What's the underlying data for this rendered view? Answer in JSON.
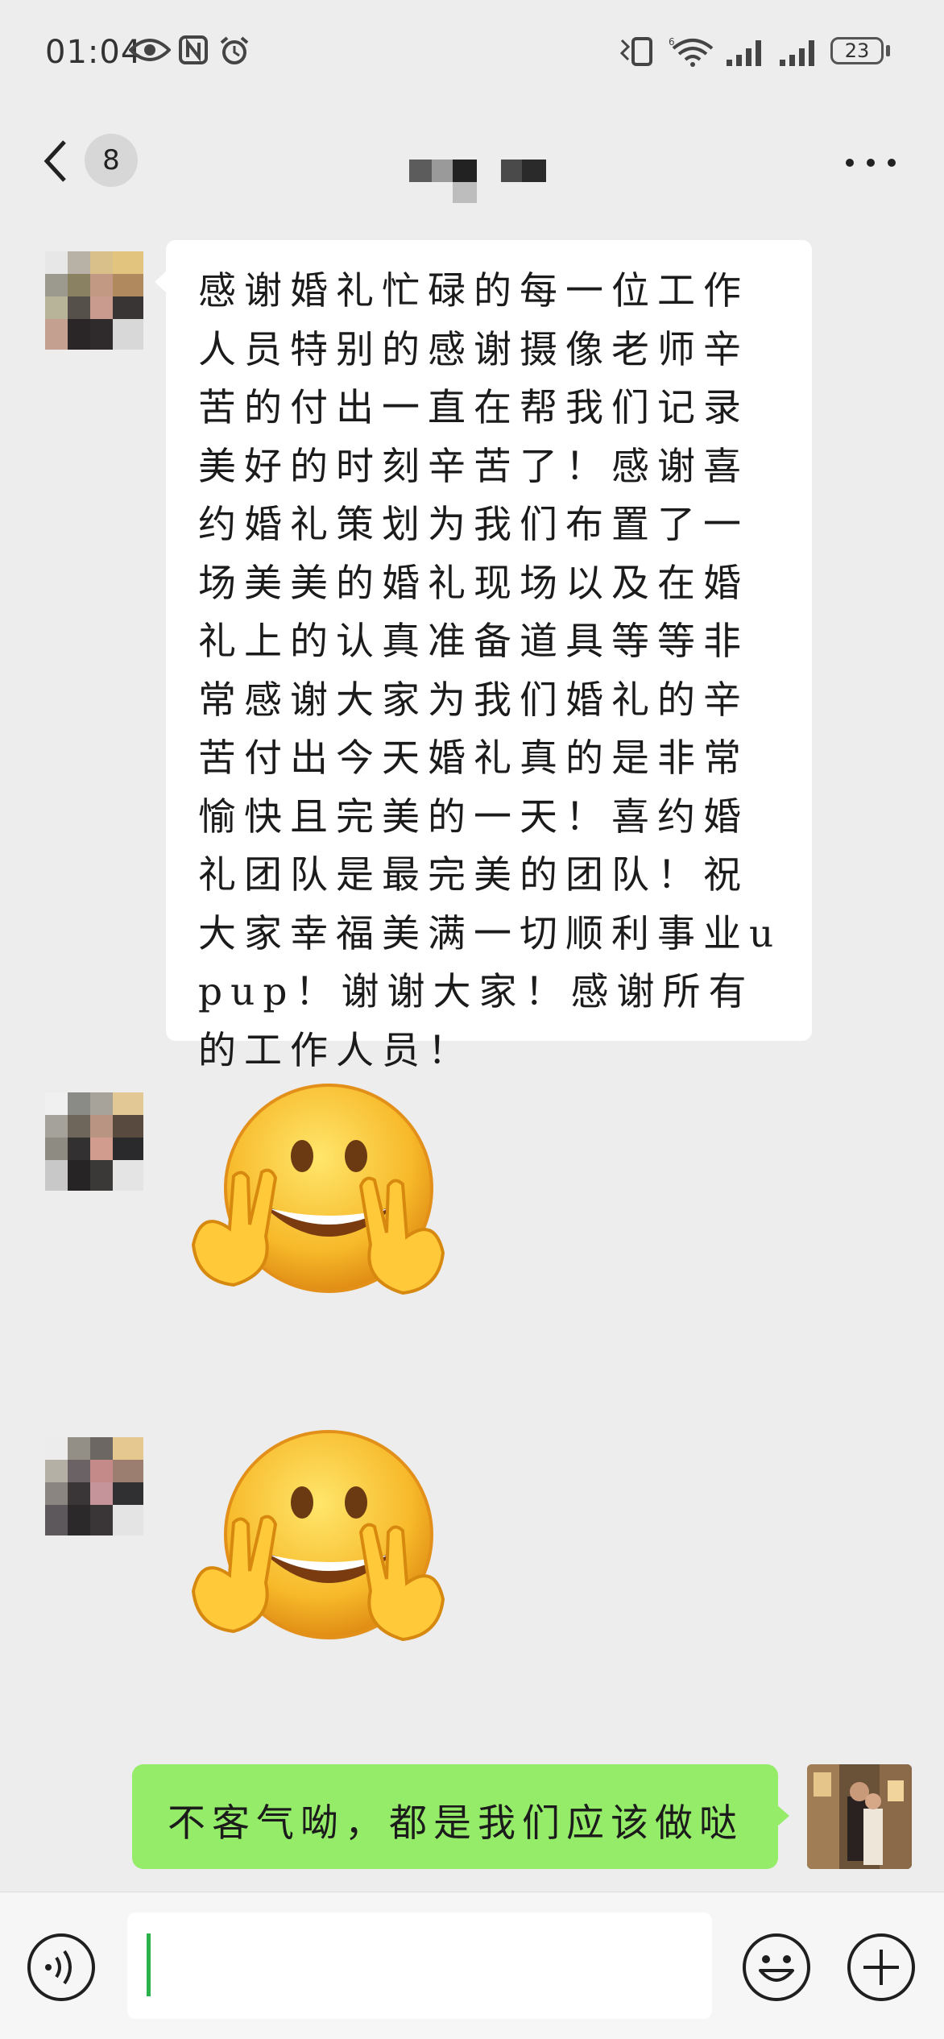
{
  "status_bar": {
    "time": "01:04",
    "battery": "23",
    "icons": [
      "eye-icon",
      "nfc-icon",
      "alarm-icon",
      "vibrate-icon",
      "wifi-6-icon",
      "signal-icon",
      "signal-icon",
      "battery-icon"
    ]
  },
  "header": {
    "unread_count": "8",
    "title_obscured": true,
    "back_icon": "chevron-left-icon",
    "more_icon": "more-dots-icon"
  },
  "messages": [
    {
      "direction": "incoming",
      "type": "text",
      "text": "感谢婚礼忙碌的每一位工作人员特别的感谢摄像老师辛苦的付出一直在帮我们记录美好的时刻辛苦了！感谢喜约婚礼策划为我们布置了一场美美的婚礼现场以及在婚礼上的认真准备道具等等非常感谢大家为我们婚礼的辛苦付出今天婚礼真的是非常愉快且完美的一天！喜约婚礼团队是最完美的团队！祝大家幸福美满一切顺利事业upup！谢谢大家！感谢所有的工作人员！"
    },
    {
      "direction": "incoming",
      "type": "sticker",
      "sticker": "grin-peace-emoji"
    },
    {
      "direction": "incoming",
      "type": "sticker",
      "sticker": "grin-peace-emoji"
    },
    {
      "direction": "outgoing",
      "type": "text",
      "text": "不客气呦，都是我们应该做哒"
    }
  ],
  "input_bar": {
    "voice_icon": "voice-icon",
    "emoji_icon": "emoji-icon",
    "plus_icon": "plus-circle-icon",
    "draft": ""
  },
  "colors": {
    "background": "#ededed",
    "incoming_bubble": "#ffffff",
    "outgoing_bubble": "#95ec69",
    "cursor": "#2bb24c"
  }
}
